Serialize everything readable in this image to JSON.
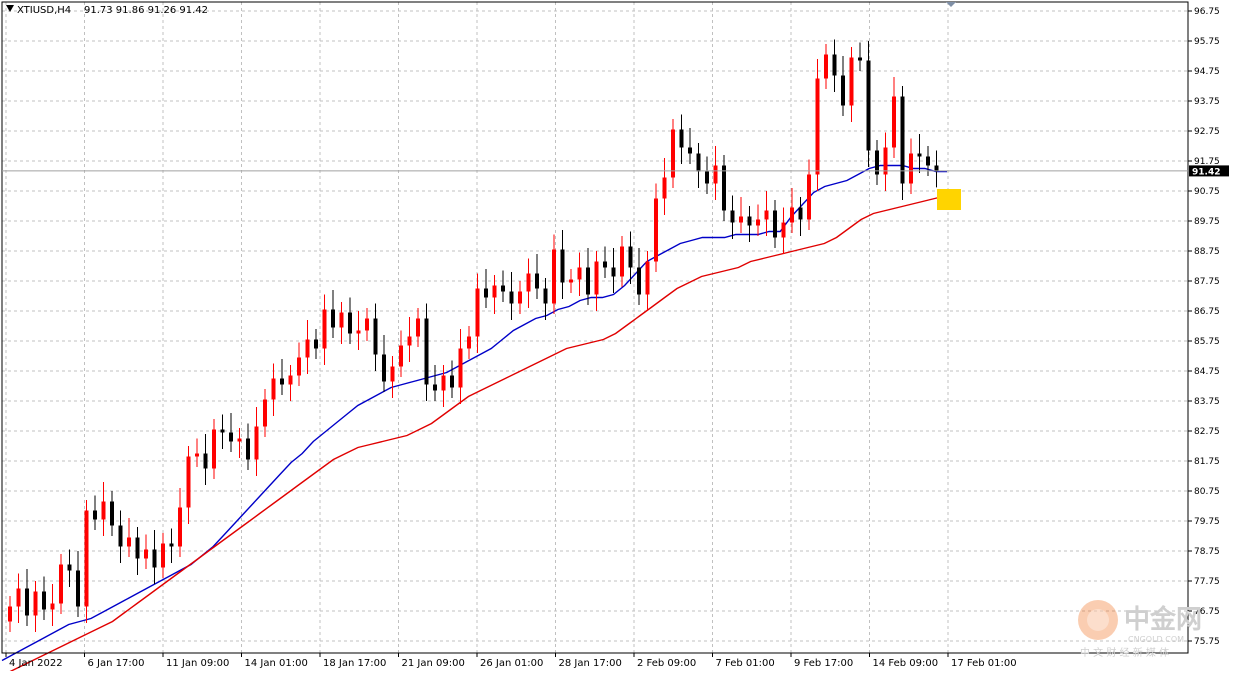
{
  "header": {
    "symbol_timeframe": "XTIUSD,H4",
    "ohlc_text": "91.73 91.86 91.26 91.42"
  },
  "current_price_label": "91.42",
  "colors": {
    "background": "#ffffff",
    "grid": "#c0c0c0",
    "bull_candle": "#ff0000",
    "bear_candle": "#000000",
    "ma_fast": "#0000c8",
    "ma_slow": "#e00000",
    "highlight": "#ffd400",
    "axis_text": "#000000",
    "watermark": "#d0d0d0"
  },
  "watermark": {
    "brand": "中金网",
    "domain": "CNGOLD.COM",
    "tagline": "中 文 财 经 新 媒 体"
  },
  "chart_data": {
    "type": "candlestick",
    "title": "XTIUSD,H4",
    "ylim": [
      75.0,
      97.1
    ],
    "y_ticks": [
      "96.75",
      "95.75",
      "94.75",
      "93.75",
      "92.75",
      "91.75",
      "90.75",
      "89.75",
      "88.75",
      "87.75",
      "86.75",
      "85.75",
      "84.75",
      "83.75",
      "82.75",
      "81.75",
      "80.75",
      "79.75",
      "78.75",
      "77.75",
      "76.75",
      "75.75"
    ],
    "x_tick_labels": [
      "4 Jan 2022",
      "6 Jan 17:00",
      "11 Jan 09:00",
      "14 Jan 01:00",
      "18 Jan 17:00",
      "21 Jan 09:00",
      "26 Jan 01:00",
      "28 Jan 17:00",
      "2 Feb 09:00",
      "7 Feb 01:00",
      "9 Feb 17:00",
      "14 Feb 09:00",
      "17 Feb 01:00"
    ],
    "grid": true,
    "last_price": 91.42,
    "candles_close": [
      76.9,
      77.5,
      76.6,
      77.4,
      76.8,
      77.0,
      78.3,
      78.1,
      76.9,
      80.1,
      79.8,
      80.4,
      79.6,
      78.9,
      79.2,
      78.5,
      78.8,
      78.2,
      79.0,
      78.9,
      80.2,
      81.9,
      82.0,
      81.5,
      82.8,
      82.7,
      82.4,
      82.5,
      81.8,
      82.9,
      83.8,
      84.5,
      84.3,
      84.6,
      85.2,
      85.8,
      85.5,
      86.8,
      86.2,
      86.7,
      86.0,
      86.1,
      86.5,
      85.3,
      84.4,
      84.9,
      85.6,
      85.9,
      86.5,
      84.3,
      84.1,
      84.6,
      84.2,
      85.5,
      85.9,
      87.5,
      87.2,
      87.6,
      87.4,
      87.0,
      87.4,
      88.0,
      87.5,
      87.0,
      88.8,
      87.7,
      87.8,
      88.2,
      87.3,
      88.4,
      88.2,
      87.9,
      88.9,
      88.2,
      87.3,
      88.4,
      90.5,
      91.2,
      92.8,
      92.2,
      92.0,
      91.4,
      91.0,
      91.6,
      90.1,
      89.7,
      89.9,
      89.6,
      89.8,
      90.1,
      89.2,
      89.7,
      90.2,
      89.8,
      91.3,
      94.5,
      95.3,
      94.6,
      93.6,
      95.2,
      95.1,
      92.1,
      91.3,
      92.2,
      93.9,
      91.0,
      92.0,
      91.9,
      91.6,
      91.42
    ],
    "series": [
      {
        "name": "",
        "type": "ma",
        "color": "#0000c8",
        "values": [
          75.1,
          75.3,
          75.5,
          75.7,
          75.9,
          76.1,
          76.3,
          76.4,
          76.5,
          76.7,
          76.9,
          77.1,
          77.3,
          77.5,
          77.7,
          77.9,
          78.1,
          78.3,
          78.6,
          78.9,
          79.3,
          79.7,
          80.1,
          80.5,
          80.9,
          81.3,
          81.7,
          82.0,
          82.4,
          82.7,
          83.0,
          83.3,
          83.6,
          83.8,
          84.0,
          84.2,
          84.3,
          84.4,
          84.5,
          84.6,
          84.7,
          84.9,
          85.1,
          85.3,
          85.5,
          85.8,
          86.1,
          86.3,
          86.5,
          86.6,
          86.8,
          86.9,
          87.1,
          87.2,
          87.2,
          87.3,
          87.6,
          88.0,
          88.4,
          88.6,
          88.8,
          89.0,
          89.1,
          89.2,
          89.2,
          89.2,
          89.3,
          89.3,
          89.3,
          89.4,
          89.4,
          89.9,
          90.3,
          90.7,
          90.9,
          91.0,
          91.1,
          91.3,
          91.5,
          91.6,
          91.6,
          91.6,
          91.5,
          91.5,
          91.4,
          91.4
        ]
      },
      {
        "name": "",
        "type": "ma",
        "color": "#e00000",
        "values": [
          74.6,
          74.8,
          75.0,
          75.2,
          75.4,
          75.6,
          75.8,
          76.0,
          76.2,
          76.4,
          76.7,
          77.0,
          77.3,
          77.6,
          77.9,
          78.2,
          78.5,
          78.8,
          79.1,
          79.4,
          79.7,
          80.0,
          80.3,
          80.6,
          80.9,
          81.2,
          81.5,
          81.8,
          82.0,
          82.2,
          82.3,
          82.4,
          82.5,
          82.6,
          82.8,
          83.0,
          83.3,
          83.6,
          83.9,
          84.1,
          84.3,
          84.5,
          84.7,
          84.9,
          85.1,
          85.3,
          85.5,
          85.6,
          85.7,
          85.8,
          86.0,
          86.3,
          86.6,
          86.9,
          87.2,
          87.5,
          87.7,
          87.9,
          88.0,
          88.1,
          88.2,
          88.4,
          88.5,
          88.6,
          88.7,
          88.8,
          88.9,
          89.0,
          89.2,
          89.5,
          89.8,
          90.0,
          90.1,
          90.2,
          90.3,
          90.4,
          90.5,
          90.6
        ]
      }
    ],
    "annotations": [
      {
        "type": "highlight_box",
        "color": "#ffd400",
        "near_value": 90.45
      }
    ]
  }
}
